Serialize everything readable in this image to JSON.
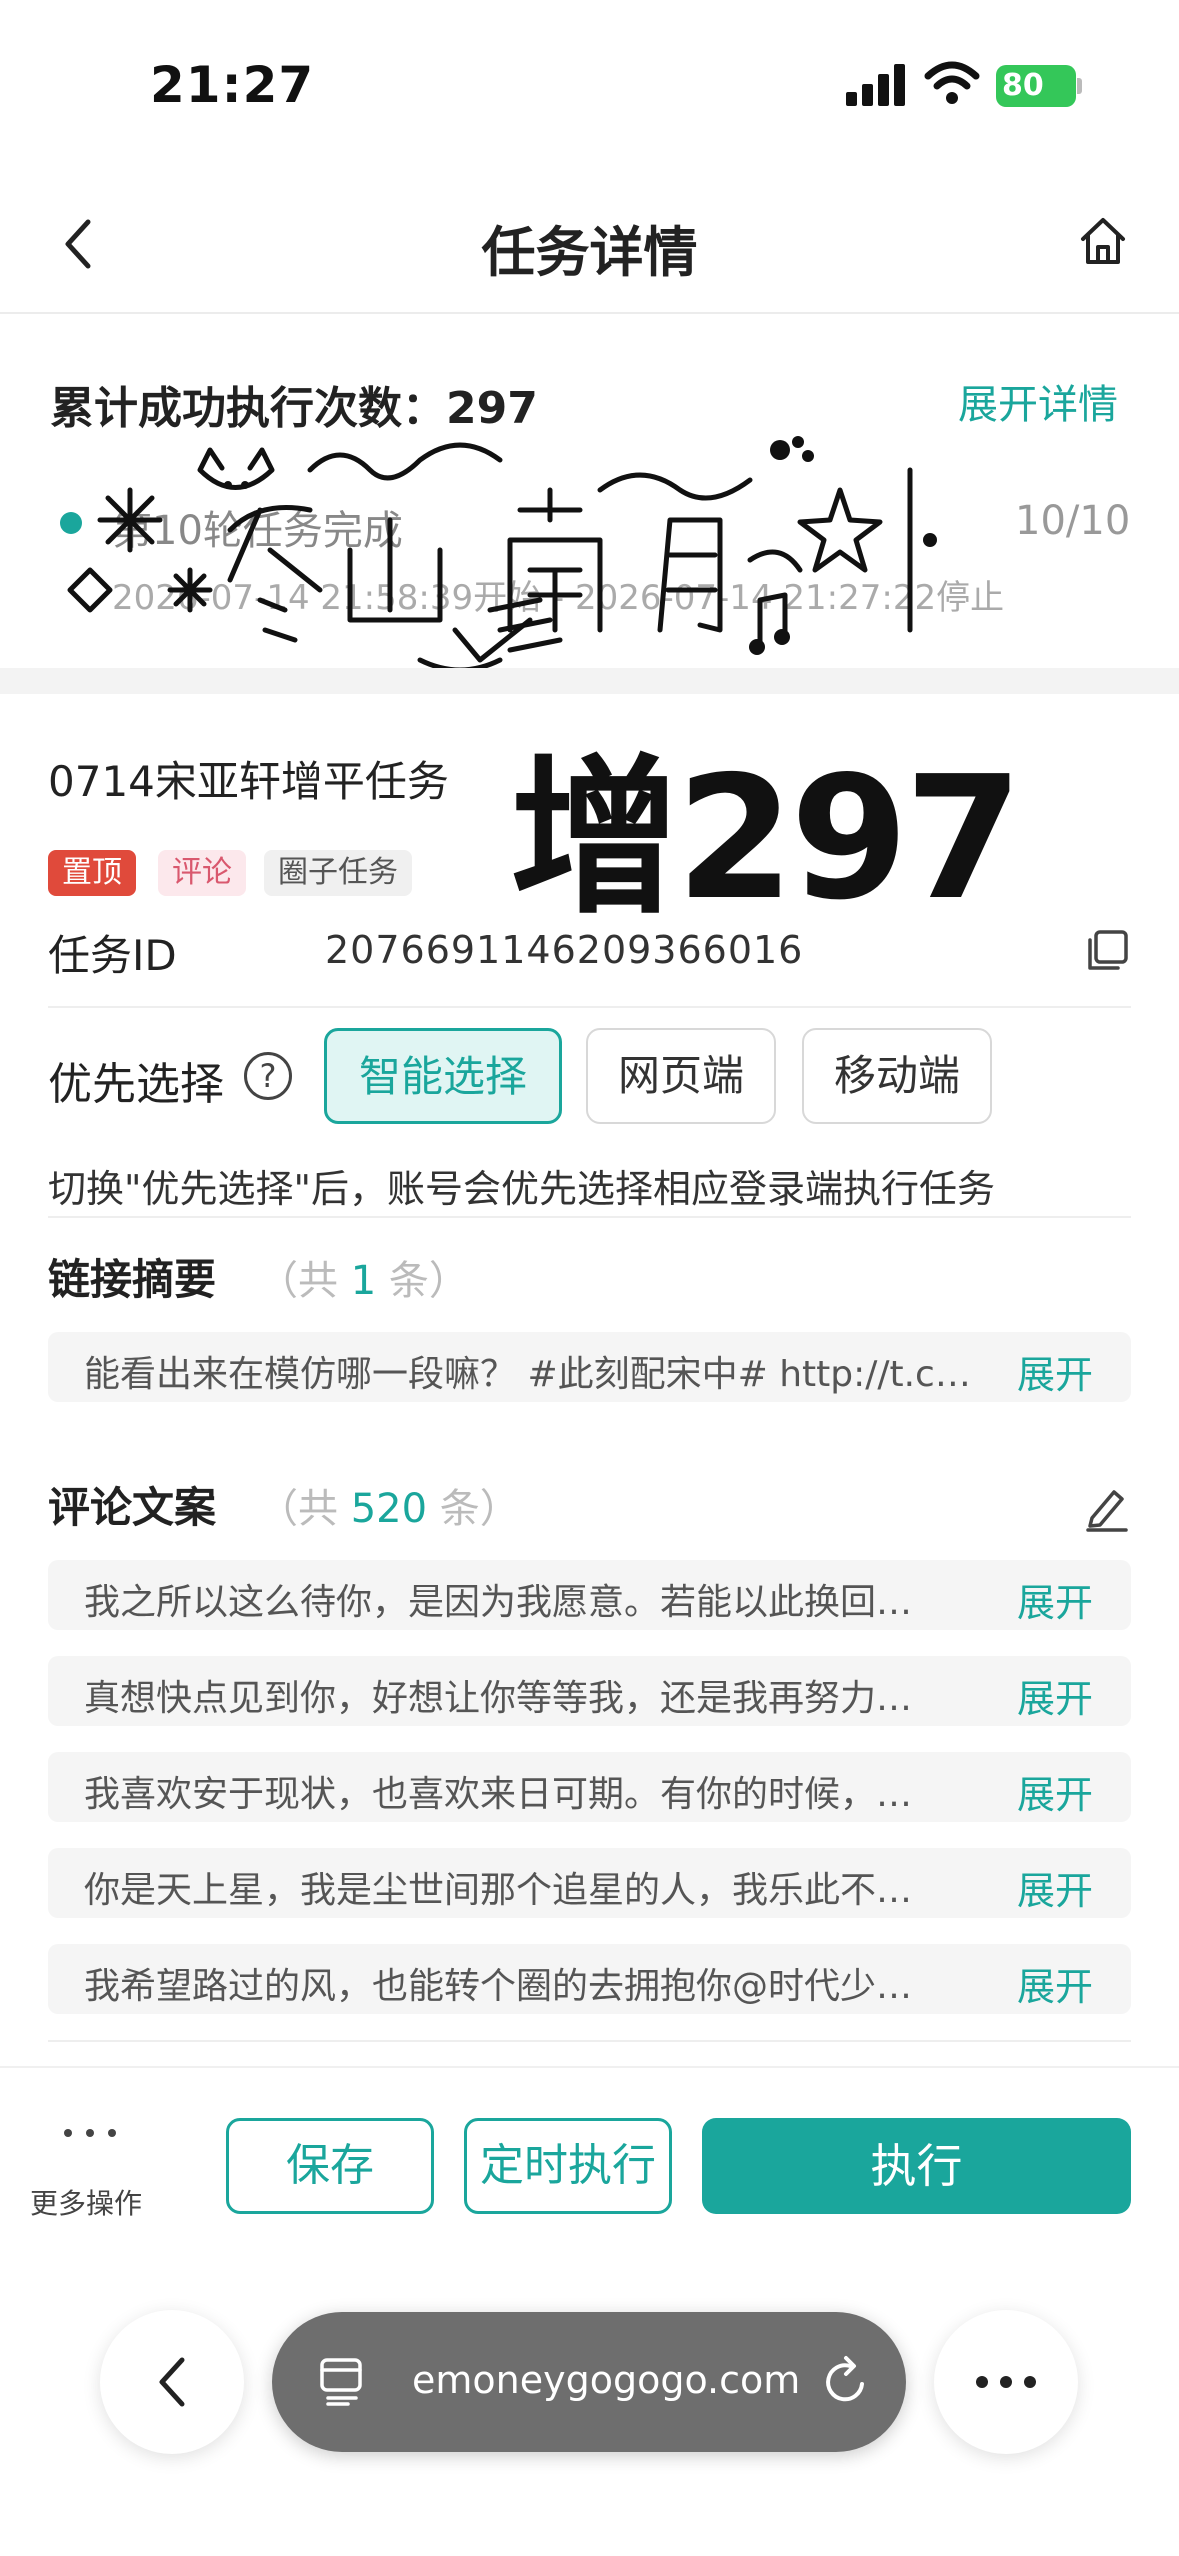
{
  "status_bar": {
    "time": "21:27",
    "battery": "80"
  },
  "nav": {
    "title": "任务详情"
  },
  "stats": {
    "label": "累计成功执行次数：297",
    "expand_label": "展开详情",
    "run_status": "第10轮任务完成",
    "run_count": "10/10",
    "run_time": "2026-07-14 21:58:39开始 - 2026-07-14 21:27:22停止"
  },
  "overlay": {
    "text": "增297",
    "signature": "冬山南月"
  },
  "task": {
    "name": "0714宋亚轩增平任务",
    "tags": [
      "置顶",
      "评论",
      "圈子任务"
    ],
    "id_label": "任务ID",
    "id_value": "2076691146209366016",
    "priority_label": "优先选择",
    "priority_options": [
      "智能选择",
      "网页端",
      "移动端"
    ],
    "priority_selected": "智能选择",
    "priority_hint": "切换\"优先选择\"后，账号会优先选择相应登录端执行任务"
  },
  "link_section": {
    "title": "链接摘要",
    "count_prefix": "（共",
    "count": "1",
    "count_suffix": "条）",
    "items": [
      {
        "text": "能看出来在模仿哪一段嘛？  #此刻配宋中# http://t.cn/...",
        "expand": "展开"
      }
    ]
  },
  "comment_section": {
    "title": "评论文案",
    "count_prefix": "（共",
    "count": "520",
    "count_suffix": "条）",
    "items": [
      {
        "text": "我之所以这么待你，是因为我愿意。若能以此换回…",
        "expand": "展开"
      },
      {
        "text": "真想快点见到你，好想让你等等我，还是我再努力…",
        "expand": "展开"
      },
      {
        "text": "我喜欢安于现状，也喜欢来日可期。有你的时候，…",
        "expand": "展开"
      },
      {
        "text": "你是天上星，我是尘世间那个追星的人，我乐此不…",
        "expand": "展开"
      },
      {
        "text": "我希望路过的风，也能转个圈的去拥抱你@时代少…",
        "expand": "展开"
      }
    ]
  },
  "actions": {
    "more_label": "更多操作",
    "save_label": "保存",
    "schedule_label": "定时执行",
    "run_label": "执行"
  },
  "browser": {
    "url": "emoneygogogo.com"
  },
  "colors": {
    "accent": "#1aa69c",
    "top_tag": "#e04a3b",
    "comment_tag": "#d9586e"
  }
}
